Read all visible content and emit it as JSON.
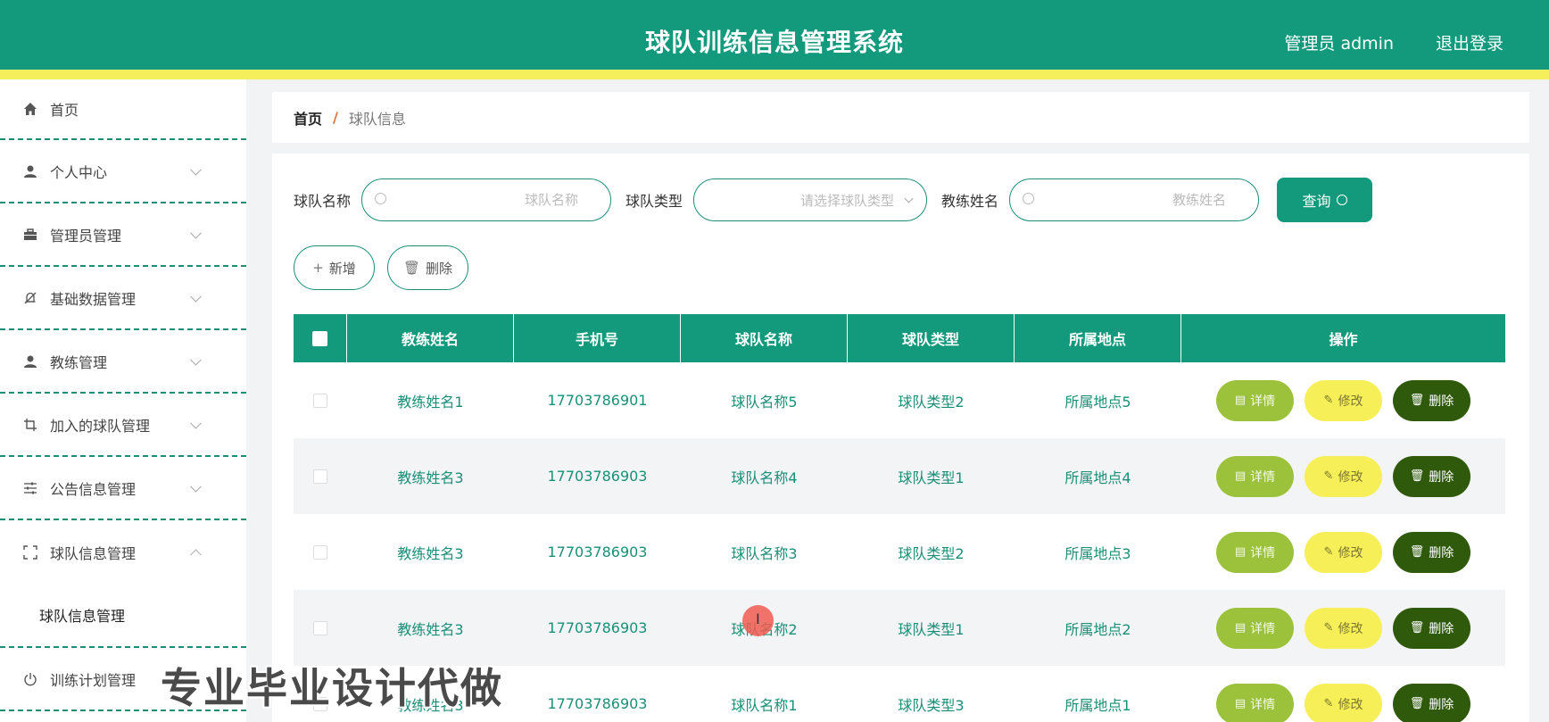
{
  "header": {
    "title": "球队训练信息管理系统",
    "admin_label": "管理员 admin",
    "logout_label": "退出登录"
  },
  "sidebar": {
    "items": [
      {
        "label": "首页",
        "icon": "home-icon"
      },
      {
        "label": "个人中心",
        "icon": "user-icon"
      },
      {
        "label": "管理员管理",
        "icon": "briefcase-icon"
      },
      {
        "label": "基础数据管理",
        "icon": "bell-off-icon"
      },
      {
        "label": "教练管理",
        "icon": "user-icon"
      },
      {
        "label": "加入的球队管理",
        "icon": "crop-icon"
      },
      {
        "label": "公告信息管理",
        "icon": "sliders-icon"
      },
      {
        "label": "球队信息管理",
        "icon": "scan-icon"
      },
      {
        "label": "训练计划管理",
        "icon": "power-icon"
      }
    ],
    "submenu_label": "球队信息管理"
  },
  "breadcrumb": {
    "home": "首页",
    "separator": "/",
    "current": "球队信息"
  },
  "search": {
    "team_name_label": "球队名称",
    "team_name_placeholder": "球队名称",
    "team_type_label": "球队类型",
    "team_type_placeholder": "请选择球队类型",
    "coach_name_label": "教练姓名",
    "coach_name_placeholder": "教练姓名",
    "query_label": "查询"
  },
  "actions": {
    "add_label": "新增",
    "delete_label": "删除"
  },
  "table": {
    "headers": [
      "教练姓名",
      "手机号",
      "球队名称",
      "球队类型",
      "所属地点",
      "操作"
    ],
    "rows": [
      [
        "教练姓名1",
        "17703786901",
        "球队名称5",
        "球队类型2",
        "所属地点5"
      ],
      [
        "教练姓名3",
        "17703786903",
        "球队名称4",
        "球队类型1",
        "所属地点4"
      ],
      [
        "教练姓名3",
        "17703786903",
        "球队名称3",
        "球队类型2",
        "所属地点3"
      ],
      [
        "教练姓名3",
        "17703786903",
        "球队名称2",
        "球队类型1",
        "所属地点2"
      ],
      [
        "教练姓名3",
        "17703786903",
        "球队名称1",
        "球队类型3",
        "所属地点1"
      ]
    ],
    "btn_detail": "详情",
    "btn_edit": "修改",
    "btn_delete": "删除"
  },
  "overlay": {
    "watermark": "专业毕业设计代做",
    "cursor": "I"
  },
  "colors": {
    "primary": "#139a7c",
    "accent_yellow": "#f4ef5a",
    "detail_green": "#9bc23a",
    "edit_yellow": "#f7ef57",
    "delete_dark": "#2f5a0c"
  }
}
